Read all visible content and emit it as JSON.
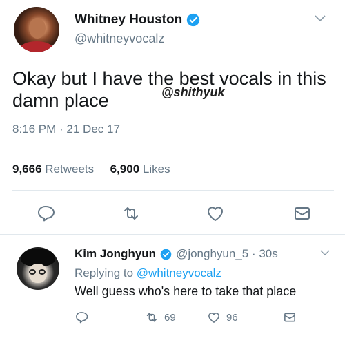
{
  "tweet": {
    "display_name": "Whitney Houston",
    "handle": "@whitneyvocalz",
    "text_line1": "Okay but I have the best vocals in this",
    "text_line2": "damn place",
    "watermark": "@shithyuk",
    "timestamp": "8:16 PM · 21 Dec 17",
    "retweet_count": "9,666",
    "retweet_label": "Retweets",
    "like_count": "6,900",
    "like_label": "Likes",
    "actions": [
      "reply-icon",
      "retweet-icon",
      "like-icon",
      "message-icon"
    ]
  },
  "reply": {
    "display_name": "Kim Jonghyun",
    "handle_time": "@jonghyun_5 · 30s",
    "replying_prefix": "Replying to",
    "replying_to": "@whitneyvocalz",
    "text": "Well guess who's here to take that place",
    "retweet_count": "69",
    "like_count": "96"
  },
  "colors": {
    "verified": "#1da1f2",
    "secondary_text": "#657786",
    "icon": "#657786",
    "link": "#1da1f2"
  }
}
